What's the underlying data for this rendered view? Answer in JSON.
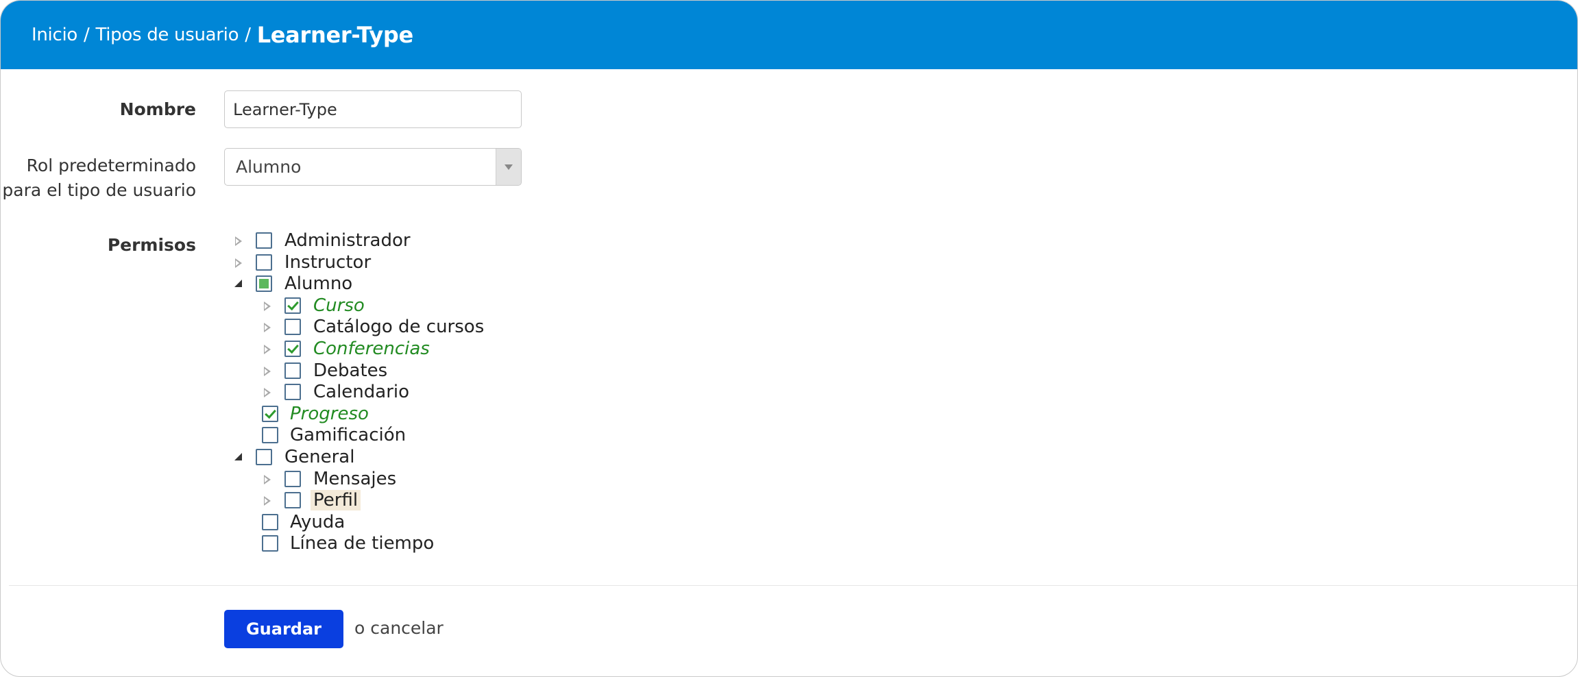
{
  "breadcrumb": {
    "home": "Inicio",
    "section": "Tipos de usuario",
    "separator": "/",
    "current": "Learner-Type"
  },
  "form": {
    "name_label": "Nombre",
    "name_value": "Learner-Type",
    "role_label_line1": "Rol predeterminado",
    "role_label_line2": "para el tipo de usuario",
    "role_value": "Alumno",
    "permissions_label": "Permisos"
  },
  "permissions": [
    {
      "label": "Administrador",
      "state": "unchecked",
      "toggle": "closed",
      "level": 0
    },
    {
      "label": "Instructor",
      "state": "unchecked",
      "toggle": "closed",
      "level": 0
    },
    {
      "label": "Alumno",
      "state": "partial",
      "toggle": "open",
      "level": 0
    },
    {
      "label": "Curso",
      "state": "checked",
      "toggle": "closed",
      "level": 1
    },
    {
      "label": "Catálogo de cursos",
      "state": "unchecked",
      "toggle": "closed",
      "level": 1
    },
    {
      "label": "Conferencias",
      "state": "checked",
      "toggle": "closed",
      "level": 1
    },
    {
      "label": "Debates",
      "state": "unchecked",
      "toggle": "closed",
      "level": 1
    },
    {
      "label": "Calendario",
      "state": "unchecked",
      "toggle": "closed",
      "level": 1
    },
    {
      "label": "Progreso",
      "state": "checked",
      "toggle": "none",
      "level": 1
    },
    {
      "label": "Gamificación",
      "state": "unchecked",
      "toggle": "none",
      "level": 1
    },
    {
      "label": "General",
      "state": "unchecked",
      "toggle": "open",
      "level": 0
    },
    {
      "label": "Mensajes",
      "state": "unchecked",
      "toggle": "closed",
      "level": 1
    },
    {
      "label": "Perfil",
      "state": "unchecked",
      "toggle": "closed",
      "level": 1,
      "highlighted": true
    },
    {
      "label": "Ayuda",
      "state": "unchecked",
      "toggle": "none",
      "level": 1
    },
    {
      "label": "Línea de tiempo",
      "state": "unchecked",
      "toggle": "none",
      "level": 1
    }
  ],
  "actions": {
    "save_label": "Guardar",
    "or_text": "o",
    "cancel_label": "cancelar"
  },
  "colors": {
    "header": "#0086d6",
    "save_button": "#0a3fe0",
    "checked_label": "#228b22",
    "partial_fill": "#5cb85c"
  }
}
